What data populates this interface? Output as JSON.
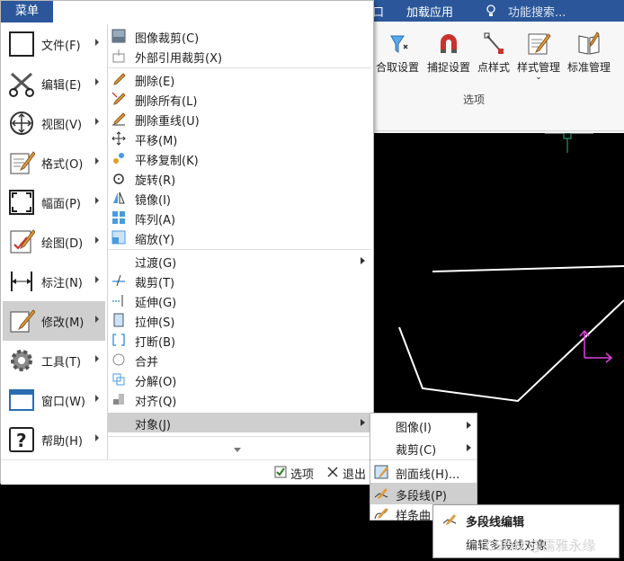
{
  "ribbon": {
    "menu_tab": "菜单",
    "tabs": [
      "加载应用"
    ],
    "partial_tab": "口",
    "search_placeholder": "功能搜索...",
    "buttons": [
      {
        "label": "合取设置",
        "icon": "object-snap-funnel-icon"
      },
      {
        "label": "捕捉设置",
        "icon": "magnet-icon"
      },
      {
        "label": "点样式",
        "icon": "point-style-icon"
      },
      {
        "label": "样式管理",
        "icon": "style-manager-icon"
      },
      {
        "label": "标准管理",
        "icon": "standards-book-icon"
      }
    ],
    "group_label": "选项"
  },
  "menu": {
    "title": "菜单",
    "left_items": [
      {
        "label": "文件(F)",
        "icon": "folder-icon"
      },
      {
        "label": "编辑(E)",
        "icon": "scissors-icon"
      },
      {
        "label": "视图(V)",
        "icon": "view-icon"
      },
      {
        "label": "格式(O)",
        "icon": "format-icon"
      },
      {
        "label": "幅面(P)",
        "icon": "frame-icon"
      },
      {
        "label": "绘图(D)",
        "icon": "draw-icon"
      },
      {
        "label": "标注(N)",
        "icon": "dimension-icon"
      },
      {
        "label": "修改(M)",
        "icon": "modify-icon"
      },
      {
        "label": "工具(T)",
        "icon": "gear-icon"
      },
      {
        "label": "窗口(W)",
        "icon": "window-icon"
      },
      {
        "label": "帮助(H)",
        "icon": "help-icon"
      }
    ],
    "right_items": [
      {
        "label": "图像裁剪(C)",
        "icon": "image-clip-icon"
      },
      {
        "label": "外部引用裁剪(X)",
        "icon": "xref-clip-icon"
      },
      {
        "label": "删除(E)",
        "icon": "erase-icon"
      },
      {
        "label": "删除所有(L)",
        "icon": "erase-all-icon"
      },
      {
        "label": "删除重线(U)",
        "icon": "erase-overlap-icon"
      },
      {
        "label": "平移(M)",
        "icon": "move-icon"
      },
      {
        "label": "平移复制(K)",
        "icon": "copy-move-icon"
      },
      {
        "label": "旋转(R)",
        "icon": "rotate-icon"
      },
      {
        "label": "镜像(I)",
        "icon": "mirror-icon"
      },
      {
        "label": "阵列(A)",
        "icon": "array-icon"
      },
      {
        "label": "缩放(Y)",
        "icon": "scale-icon"
      },
      {
        "label": "过渡(G)",
        "icon": ""
      },
      {
        "label": "裁剪(T)",
        "icon": "trim-icon"
      },
      {
        "label": "延伸(G)",
        "icon": "extend-icon"
      },
      {
        "label": "拉伸(S)",
        "icon": "stretch-icon"
      },
      {
        "label": "打断(B)",
        "icon": "break-icon"
      },
      {
        "label": "合并",
        "icon": "join-icon"
      },
      {
        "label": "分解(O)",
        "icon": "explode-icon"
      },
      {
        "label": "对齐(Q)",
        "icon": "align-icon"
      },
      {
        "label": "对象(J)",
        "icon": ""
      }
    ],
    "footer": {
      "options": "选项",
      "exit": "退出"
    }
  },
  "submenu": [
    {
      "label": "图像(I)"
    },
    {
      "label": "裁剪(C)"
    },
    {
      "label": "剖面线(H)..."
    },
    {
      "label": "多段线(P)"
    },
    {
      "label": "样条曲"
    }
  ],
  "tooltip": {
    "title": "多段线编辑",
    "desc": "编辑多段线对象"
  },
  "watermark": "CSDN @儒雅永缘",
  "colors": {
    "accent": "#2b579a",
    "selection": "#cfcfcf",
    "ucs": "#e040e0"
  }
}
